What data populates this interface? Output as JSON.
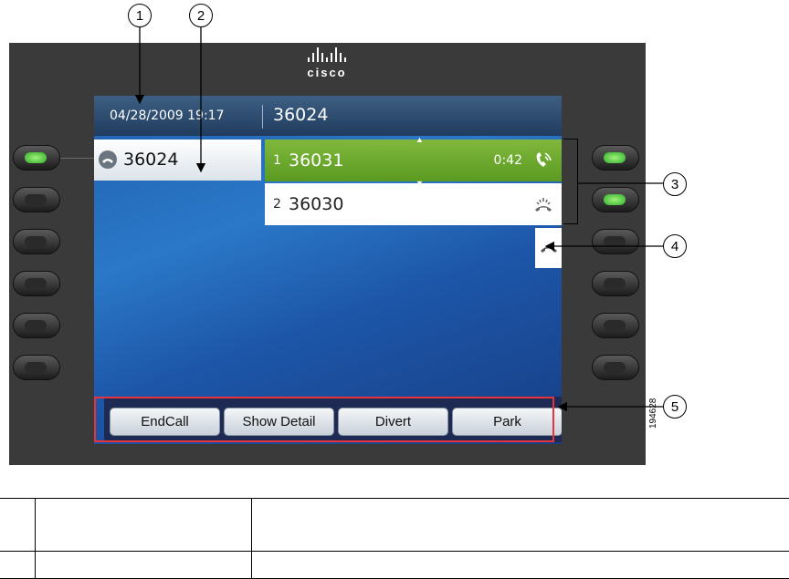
{
  "callouts": [
    "1",
    "2",
    "3",
    "4",
    "5"
  ],
  "header": {
    "datetime": "04/28/2009 19:17",
    "number": "36024"
  },
  "line": {
    "label": "36024",
    "icon": "ringing-phone-icon"
  },
  "calls": [
    {
      "index": "1",
      "number": "36031",
      "timer": "0:42",
      "state_icon": "active-call-icon",
      "color": "#6aa82b"
    },
    {
      "index": "2",
      "number": "36030",
      "timer": "",
      "state_icon": "ringing-handset-icon"
    }
  ],
  "softkeys": [
    "EndCall",
    "Show Detail",
    "Divert",
    "Park"
  ],
  "brand": "cisco",
  "figure_id": "194628",
  "colors": {
    "highlight_box": "#e8323c",
    "lamp_green": "#2fae2a"
  }
}
